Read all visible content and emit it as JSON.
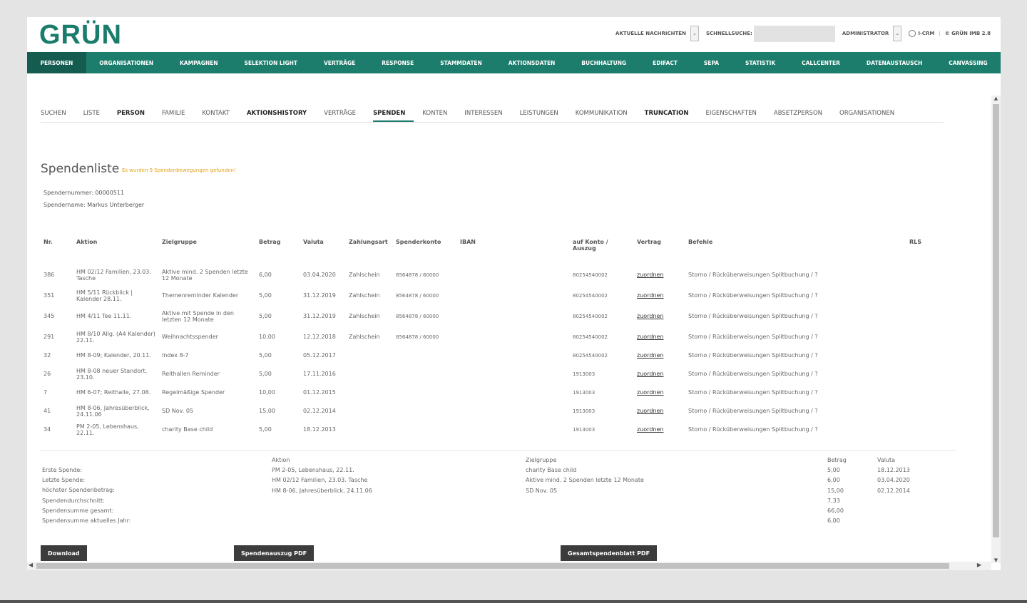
{
  "brand": {
    "logo": "GRÜN"
  },
  "topbar": {
    "news_label": "AKTUELLE NACHRICHTEN",
    "search_label": "SCHNELLSUCHE:",
    "search_value": "",
    "user_label": "ADMINISTRATOR",
    "crm_label": "I-CRM",
    "version_label": "© GRÜN IMB 2.8"
  },
  "main_nav": [
    "PERSONEN",
    "ORGANISATIONEN",
    "KAMPAGNEN",
    "SELEKTION LIGHT",
    "VERTRÄGE",
    "RESPONSE",
    "STAMMDATEN",
    "AKTIONSDATEN",
    "BUCHHALTUNG",
    "EDIFACT",
    "SEPA",
    "STATISTIK",
    "CALLCENTER",
    "DATENAUSTAUSCH",
    "CANVASSING"
  ],
  "main_nav_active": "PERSONEN",
  "sub_nav": [
    {
      "label": "SUCHEN",
      "style": ""
    },
    {
      "label": "LISTE",
      "style": ""
    },
    {
      "label": "PERSON",
      "style": "bold"
    },
    {
      "label": "FAMILIE",
      "style": ""
    },
    {
      "label": "KONTAKT",
      "style": ""
    },
    {
      "label": "AKTIONSHISTORY",
      "style": "bold"
    },
    {
      "label": "VERTRÄGE",
      "style": ""
    },
    {
      "label": "SPENDEN",
      "style": "active"
    },
    {
      "label": "KONTEN",
      "style": ""
    },
    {
      "label": "INTERESSEN",
      "style": ""
    },
    {
      "label": "LEISTUNGEN",
      "style": ""
    },
    {
      "label": "KOMMUNIKATION",
      "style": ""
    },
    {
      "label": "TRUNCATION",
      "style": "bold"
    },
    {
      "label": "EIGENSCHAFTEN",
      "style": ""
    },
    {
      "label": "ABSETZPERSON",
      "style": ""
    },
    {
      "label": "ORGANISATIONEN",
      "style": ""
    }
  ],
  "page": {
    "title": "Spendenliste",
    "found_message": "Es wurden 9 Spendenbewegungen gefunden!",
    "donor_number_label": "Spendernummer:",
    "donor_number": "00000511",
    "donor_name_label": "Spendername:",
    "donor_name": "Markus Unterberger"
  },
  "table": {
    "columns": [
      "Nr.",
      "Aktion",
      "Zielgruppe",
      "Betrag",
      "Valuta",
      "Zahlungsart",
      "Spenderkonto",
      "IBAN",
      "auf Konto / Auszug",
      "Vertrag",
      "Befehle",
      "RLS"
    ],
    "rows": [
      {
        "nr": "386",
        "aktion": "HM 02/12 Familien, 23.03. Tasche",
        "zielgruppe": "Aktive mind. 2 Spenden letzte 12 Monate",
        "betrag": "6,00",
        "valuta": "03.04.2020",
        "zahlungsart": "Zahlschein",
        "spenderkonto": "8564878 / 60000",
        "iban": "",
        "konto": "80254540002",
        "vertrag": "zuordnen",
        "befehle": "Storno / Rücküberweisungen Splitbuchung / ?",
        "rls": ""
      },
      {
        "nr": "351",
        "aktion": "HM 5/11 Rückblick | Kalender 28.11.",
        "zielgruppe": "Themenreminder Kalender",
        "betrag": "5,00",
        "valuta": "31.12.2019",
        "zahlungsart": "Zahlschein",
        "spenderkonto": "8564878 / 60000",
        "iban": "",
        "konto": "80254540002",
        "vertrag": "zuordnen",
        "befehle": "Storno / Rücküberweisungen Splitbuchung / ?",
        "rls": ""
      },
      {
        "nr": "345",
        "aktion": "HM 4/11 Tee 11.11.",
        "zielgruppe": "Aktive mit Spende in den letzten 12 Monate",
        "betrag": "5,00",
        "valuta": "31.12.2019",
        "zahlungsart": "Zahlschein",
        "spenderkonto": "8564878 / 60000",
        "iban": "",
        "konto": "80254540002",
        "vertrag": "zuordnen",
        "befehle": "Storno / Rücküberweisungen Splitbuchung / ?",
        "rls": ""
      },
      {
        "nr": "291",
        "aktion": "HM 8/10 Allg. (A4 Kalender) 22.11.",
        "zielgruppe": "Weihnachtsspender",
        "betrag": "10,00",
        "valuta": "12.12.2018",
        "zahlungsart": "Zahlschein",
        "spenderkonto": "8564878 / 60000",
        "iban": "",
        "konto": "80254540002",
        "vertrag": "zuordnen",
        "befehle": "Storno / Rücküberweisungen Splitbuchung / ?",
        "rls": ""
      },
      {
        "nr": "32",
        "aktion": "HM 8-09; Kalender, 20.11.",
        "zielgruppe": "Index 8-7",
        "betrag": "5,00",
        "valuta": "05.12.2017",
        "zahlungsart": "",
        "spenderkonto": "",
        "iban": "",
        "konto": "80254540002",
        "vertrag": "zuordnen",
        "befehle": "Storno / Rücküberweisungen Splitbuchung / ?",
        "rls": ""
      },
      {
        "nr": "26",
        "aktion": "HM 8-08 neuer Standort, 23.10.",
        "zielgruppe": "Reithallen Reminder",
        "betrag": "5,00",
        "valuta": "17.11.2016",
        "zahlungsart": "",
        "spenderkonto": "",
        "iban": "",
        "konto": "1913003",
        "vertrag": "zuordnen",
        "befehle": "Storno / Rücküberweisungen Splitbuchung / ?",
        "rls": ""
      },
      {
        "nr": "7",
        "aktion": "HM 6-07; Reithalle, 27.08.",
        "zielgruppe": "Regelmäßige Spender",
        "betrag": "10,00",
        "valuta": "01.12.2015",
        "zahlungsart": "",
        "spenderkonto": "",
        "iban": "",
        "konto": "1913003",
        "vertrag": "zuordnen",
        "befehle": "Storno / Rücküberweisungen Splitbuchung / ?",
        "rls": ""
      },
      {
        "nr": "41",
        "aktion": "HM 8-06, Jahresüberblick, 24.11.06",
        "zielgruppe": "SD Nov. 05",
        "betrag": "15,00",
        "valuta": "02.12.2014",
        "zahlungsart": "",
        "spenderkonto": "",
        "iban": "",
        "konto": "1913003",
        "vertrag": "zuordnen",
        "befehle": "Storno / Rücküberweisungen Splitbuchung / ?",
        "rls": ""
      },
      {
        "nr": "34",
        "aktion": "PM 2-05, Lebenshaus, 22.11.",
        "zielgruppe": "charity Base child",
        "betrag": "5,00",
        "valuta": "18.12.2013",
        "zahlungsart": "",
        "spenderkonto": "",
        "iban": "",
        "konto": "1913003",
        "vertrag": "zuordnen",
        "befehle": "Storno / Rücküberweisungen Splitbuchung / ?",
        "rls": ""
      }
    ]
  },
  "summary": {
    "headers": {
      "aktion": "Aktion",
      "zielgruppe": "Zielgruppe",
      "betrag": "Betrag",
      "valuta": "Valuta"
    },
    "labels": [
      "Erste Spende:",
      "Letzte Spende:",
      "höchster Spendenbetrag:",
      "Spendendurchschnitt:",
      "Spendensumme gesamt:",
      "Spendensumme aktuelles Jahr:"
    ],
    "aktion": [
      "PM 2-05, Lebenshaus, 22.11.",
      "HM 02/12 Familien, 23.03. Tasche",
      "HM 8-06, Jahresüberblick, 24.11.06"
    ],
    "zielgruppe": [
      "charity Base child",
      "Aktive mind. 2 Spenden letzte 12 Monate",
      "SD Nov. 05"
    ],
    "betrag": [
      "5,00",
      "6,00",
      "15,00",
      "7,33",
      "66,00",
      "6,00"
    ],
    "valuta": [
      "18.12.2013",
      "03.04.2020",
      "02.12.2014"
    ]
  },
  "buttons": {
    "download": "Download",
    "auszug": "Spendenauszug PDF",
    "gesamt": "Gesamtspendenblatt PDF"
  }
}
